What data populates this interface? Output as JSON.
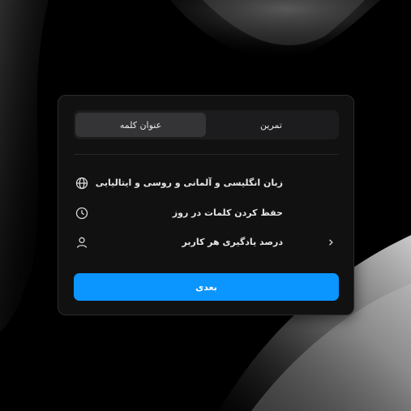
{
  "tabs": {
    "practice": "تمرین",
    "word_title": "عنوان کلمه",
    "active": "word_title"
  },
  "features": [
    {
      "icon": "globe-icon",
      "label": "زبان انگلیسی و آلمانی و روسی و ایتالیایی"
    },
    {
      "icon": "clock-icon",
      "label": "حفظ کردن کلمات در روز"
    },
    {
      "icon": "user-icon",
      "label": "درصد یادگیری هر کاربر",
      "trailing_icon": "chevron-right-icon"
    }
  ],
  "next_button": {
    "label": "بعدی"
  },
  "colors": {
    "background": "#000000",
    "card": "#111112",
    "accent": "#0a95ff",
    "text": "#e6e6e6"
  }
}
